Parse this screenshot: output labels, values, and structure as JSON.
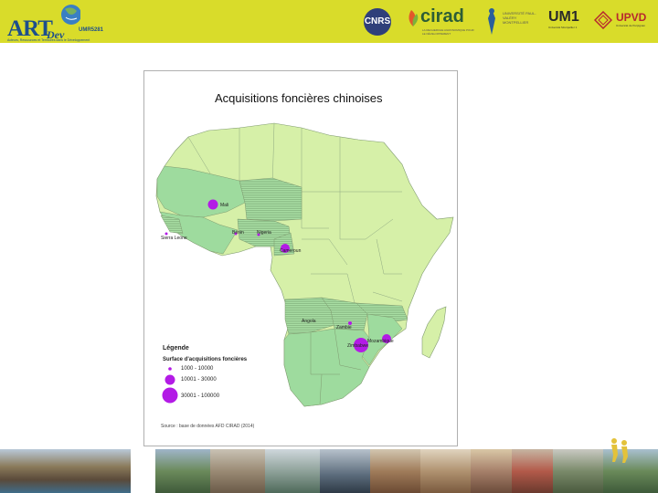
{
  "header": {
    "artdev_word": "ART",
    "artdev_dev": "Dev",
    "artdev_umr": "UMR5281",
    "artdev_tagline": "Acteurs, Ressources et Territoires dans le Développement",
    "cnrs": "CNRS",
    "cirad": "cirad",
    "cirad_sub": "LA RECHERCHE AGRONOMIQUE POUR LE DÉVELOPPEMENT",
    "umontp": "UNIVERSITÉ PAUL-VALÉRY MONTPELLIER",
    "um1": "UM1",
    "um1_sub": "Université Montpellier 1",
    "upvd": "UPVD"
  },
  "map": {
    "title": "Acquisitions foncières chinoises",
    "countries": {
      "mali": "Mali",
      "sierra_leone": "Sierra Leone",
      "benin": "Bénin",
      "nigeria": "Nigeria",
      "cameroon": "Cameroun",
      "angola": "Angola",
      "zambia": "Zambie",
      "mozambique": "Mozambique",
      "zimbabwe": "Zimbabwe"
    },
    "legend_title": "Légende",
    "legend_subtitle": "Surface d'acquisitions foncières",
    "legend_items": [
      "1000 - 10000",
      "10001 - 30000",
      "30001 - 100000"
    ],
    "source": "Source : base de données AFD CIRAD (2014)",
    "colors": {
      "africa_fill": "#d6f0a8",
      "highlight_fill": "#9edb9e",
      "border": "#7f9a6f",
      "bubble": "#b31be6",
      "ocean": "#ffffff"
    }
  }
}
